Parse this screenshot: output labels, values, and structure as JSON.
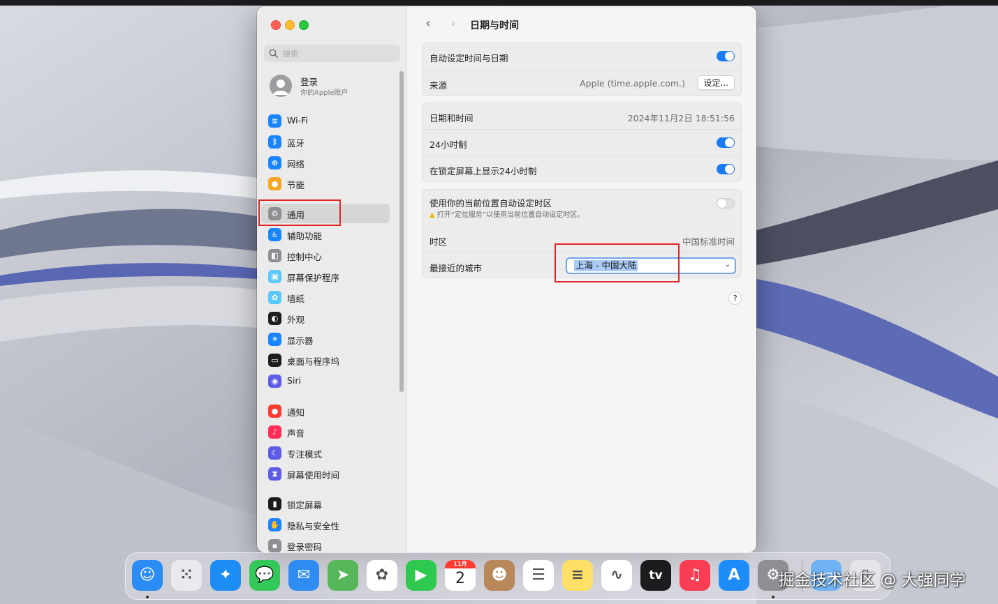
{
  "sidebar": {
    "search_placeholder": "搜索",
    "account": {
      "name": "登录",
      "subtitle": "你的Apple账户"
    },
    "groups": [
      [
        {
          "label": "Wi-Fi",
          "icon": "wifi-icon",
          "color": "#1a84ff"
        },
        {
          "label": "蓝牙",
          "icon": "bluetooth-icon",
          "color": "#1a84ff"
        },
        {
          "label": "网络",
          "icon": "globe-icon",
          "color": "#1a84ff"
        },
        {
          "label": "节能",
          "icon": "lightbulb-icon",
          "color": "#f5a623"
        }
      ],
      [
        {
          "label": "通用",
          "icon": "gear-icon",
          "color": "#8e8e93",
          "selected": true
        },
        {
          "label": "辅助功能",
          "icon": "accessibility-icon",
          "color": "#1a84ff"
        },
        {
          "label": "控制中心",
          "icon": "control-center-icon",
          "color": "#8e8e93"
        },
        {
          "label": "屏幕保护程序",
          "icon": "screensaver-icon",
          "color": "#5ac8fa"
        },
        {
          "label": "墙纸",
          "icon": "wallpaper-icon",
          "color": "#5ac8fa"
        },
        {
          "label": "外观",
          "icon": "appearance-icon",
          "color": "#1c1c1e"
        },
        {
          "label": "显示器",
          "icon": "display-icon",
          "color": "#1a84ff"
        },
        {
          "label": "桌面与程序坞",
          "icon": "dock-icon",
          "color": "#1c1c1e"
        },
        {
          "label": "Siri",
          "icon": "siri-icon",
          "color": "#5e5ce6"
        }
      ],
      [
        {
          "label": "通知",
          "icon": "bell-icon",
          "color": "#ff3b30"
        },
        {
          "label": "声音",
          "icon": "speaker-icon",
          "color": "#ff2d55"
        },
        {
          "label": "专注模式",
          "icon": "moon-icon",
          "color": "#5e5ce6"
        },
        {
          "label": "屏幕使用时间",
          "icon": "hourglass-icon",
          "color": "#5e5ce6"
        }
      ],
      [
        {
          "label": "锁定屏幕",
          "icon": "lock-icon",
          "color": "#1c1c1e"
        },
        {
          "label": "隐私与安全性",
          "icon": "hand-icon",
          "color": "#1a84ff"
        },
        {
          "label": "登录密码",
          "icon": "password-icon",
          "color": "#8e8e93"
        }
      ]
    ]
  },
  "content": {
    "title": "日期与时间",
    "auto_time": {
      "label": "自动设定时间与日期",
      "enabled": true
    },
    "source": {
      "label": "来源",
      "value": "Apple (time.apple.com.)",
      "button": "设定..."
    },
    "datetime": {
      "label": "日期和时间",
      "value": "2024年11月2日 18:51:56"
    },
    "hour24": {
      "label": "24小时制",
      "enabled": true
    },
    "lock_hour24": {
      "label": "在锁定屏幕上显示24小时制",
      "enabled": true
    },
    "auto_timezone": {
      "label": "使用你的当前位置自动设定时区",
      "warning": "打开“定位服务”以使用当前位置自动设定时区。",
      "enabled": false
    },
    "timezone": {
      "label": "时区",
      "value": "中国标准时间"
    },
    "city": {
      "label": "最接近的城市",
      "value": "上海 - 中国大陆"
    },
    "help_label": "?"
  },
  "dock": {
    "apps": [
      {
        "name": "finder",
        "icon": "finder-icon",
        "color": "#2b8cf5",
        "running": true
      },
      {
        "name": "launchpad",
        "icon": "launchpad-icon",
        "color": "#e9e9ee",
        "running": false
      },
      {
        "name": "safari",
        "icon": "safari-icon",
        "color": "#1c8df5",
        "running": false
      },
      {
        "name": "messages",
        "icon": "messages-icon",
        "color": "#34c759",
        "running": false
      },
      {
        "name": "mail",
        "icon": "mail-icon",
        "color": "#2e8cf2",
        "running": false
      },
      {
        "name": "maps",
        "icon": "maps-icon",
        "color": "#56b65a",
        "running": false
      },
      {
        "name": "photos",
        "icon": "photos-icon",
        "color": "#ffffff",
        "running": false
      },
      {
        "name": "facetime",
        "icon": "facetime-icon",
        "color": "#30c94f",
        "running": false
      },
      {
        "name": "calendar",
        "icon": "calendar-icon",
        "color": "#ffffff",
        "running": false,
        "month": "11月",
        "day": "2"
      },
      {
        "name": "contacts",
        "icon": "contacts-icon",
        "color": "#b8875a",
        "running": false
      },
      {
        "name": "reminders",
        "icon": "reminders-icon",
        "color": "#ffffff",
        "running": false
      },
      {
        "name": "notes",
        "icon": "notes-icon",
        "color": "#ffe066",
        "running": false
      },
      {
        "name": "freeform",
        "icon": "freeform-icon",
        "color": "#ffffff",
        "running": false
      },
      {
        "name": "tv",
        "icon": "tv-icon",
        "color": "#1c1c1e",
        "running": false,
        "text": "tv"
      },
      {
        "name": "music",
        "icon": "music-icon",
        "color": "#fb3d53",
        "running": false
      },
      {
        "name": "app-store",
        "icon": "app-store-icon",
        "color": "#1d8cf8",
        "running": false
      },
      {
        "name": "system-settings",
        "icon": "gear-icon",
        "color": "#8e8e93",
        "running": true
      },
      {
        "name": "downloads",
        "icon": "folder-icon",
        "color": "#6fb3f5",
        "running": false
      },
      {
        "name": "trash",
        "icon": "trash-icon",
        "color": "#e4e6ea",
        "running": false
      }
    ]
  },
  "watermark": "掘金技术社区 @ 大强同学",
  "colors": {
    "accent": "#1a7cf5",
    "highlight_box": "#e02424"
  }
}
